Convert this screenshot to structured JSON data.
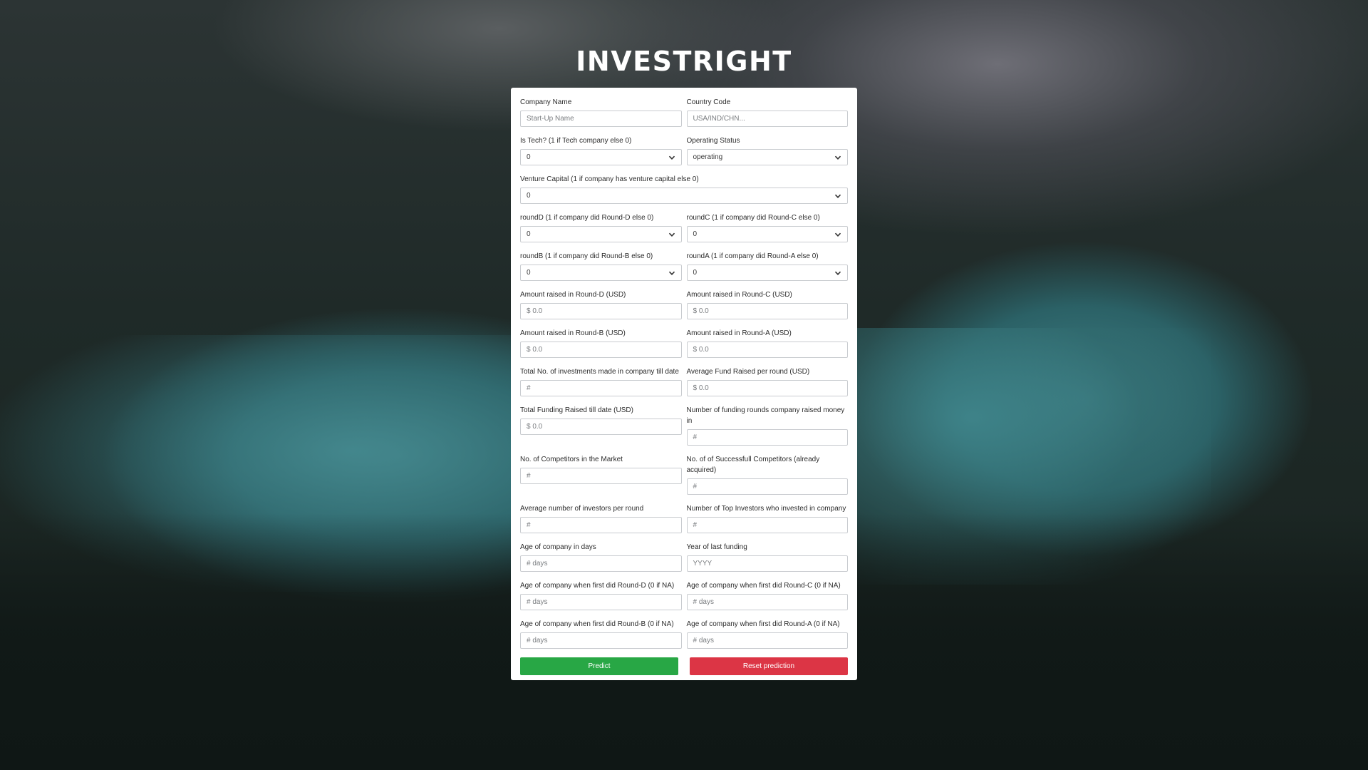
{
  "app": {
    "title": "INVESTRIGHT"
  },
  "form": {
    "company_name": {
      "label": "Company Name",
      "placeholder": "Start-Up Name"
    },
    "country_code": {
      "label": "Country Code",
      "placeholder": "USA/IND/CHN..."
    },
    "is_tech": {
      "label": "Is Tech? (1 if Tech company else 0)",
      "value": "0"
    },
    "operating_status": {
      "label": "Operating Status",
      "value": "operating"
    },
    "venture_capital": {
      "label": "Venture Capital (1 if company has venture capital else 0)",
      "value": "0"
    },
    "round_d": {
      "label": "roundD (1 if company did Round-D else 0)",
      "value": "0"
    },
    "round_c": {
      "label": "roundC (1 if company did Round-C else 0)",
      "value": "0"
    },
    "round_b": {
      "label": "roundB (1 if company did Round-B else 0)",
      "value": "0"
    },
    "round_a": {
      "label": "roundA (1 if company did Round-A else 0)",
      "value": "0"
    },
    "amount_d": {
      "label": "Amount raised in Round-D (USD)",
      "placeholder": "$ 0.0"
    },
    "amount_c": {
      "label": "Amount raised in Round-C (USD)",
      "placeholder": "$ 0.0"
    },
    "amount_b": {
      "label": "Amount raised in Round-B (USD)",
      "placeholder": "$ 0.0"
    },
    "amount_a": {
      "label": "Amount raised in Round-A (USD)",
      "placeholder": "$ 0.0"
    },
    "total_investments": {
      "label": "Total No. of investments made in company till date",
      "placeholder": "#"
    },
    "avg_fund": {
      "label": "Average Fund Raised per round (USD)",
      "placeholder": "$ 0.0"
    },
    "total_funding": {
      "label": "Total Funding Raised till date (USD)",
      "placeholder": "$ 0.0"
    },
    "num_rounds": {
      "label": "Number of funding rounds company raised money in",
      "placeholder": "#"
    },
    "competitors": {
      "label": "No. of Competitors in the Market",
      "placeholder": "#"
    },
    "successful_competitors": {
      "label": "No. of of Successfull Competitors (already acquired)",
      "placeholder": "#"
    },
    "avg_investors": {
      "label": "Average number of investors per round",
      "placeholder": "#"
    },
    "top_investors": {
      "label": "Number of Top Investors who invested in company",
      "placeholder": "#"
    },
    "age_days": {
      "label": "Age of company in days",
      "placeholder": "# days"
    },
    "last_funding_year": {
      "label": "Year of last funding",
      "placeholder": "YYYY"
    },
    "age_round_d": {
      "label": "Age of company when first did Round-D (0 if NA)",
      "placeholder": "# days"
    },
    "age_round_c": {
      "label": "Age of company when first did Round-C (0 if NA)",
      "placeholder": "# days"
    },
    "age_round_b": {
      "label": "Age of company when first did Round-B (0 if NA)",
      "placeholder": "# days"
    },
    "age_round_a": {
      "label": "Age of company when first did Round-A (0 if NA)",
      "placeholder": "# days"
    }
  },
  "buttons": {
    "predict": "Predict",
    "reset": "Reset prediction"
  },
  "colors": {
    "predict": "#28a745",
    "reset": "#dc3545",
    "card": "#ffffff"
  }
}
